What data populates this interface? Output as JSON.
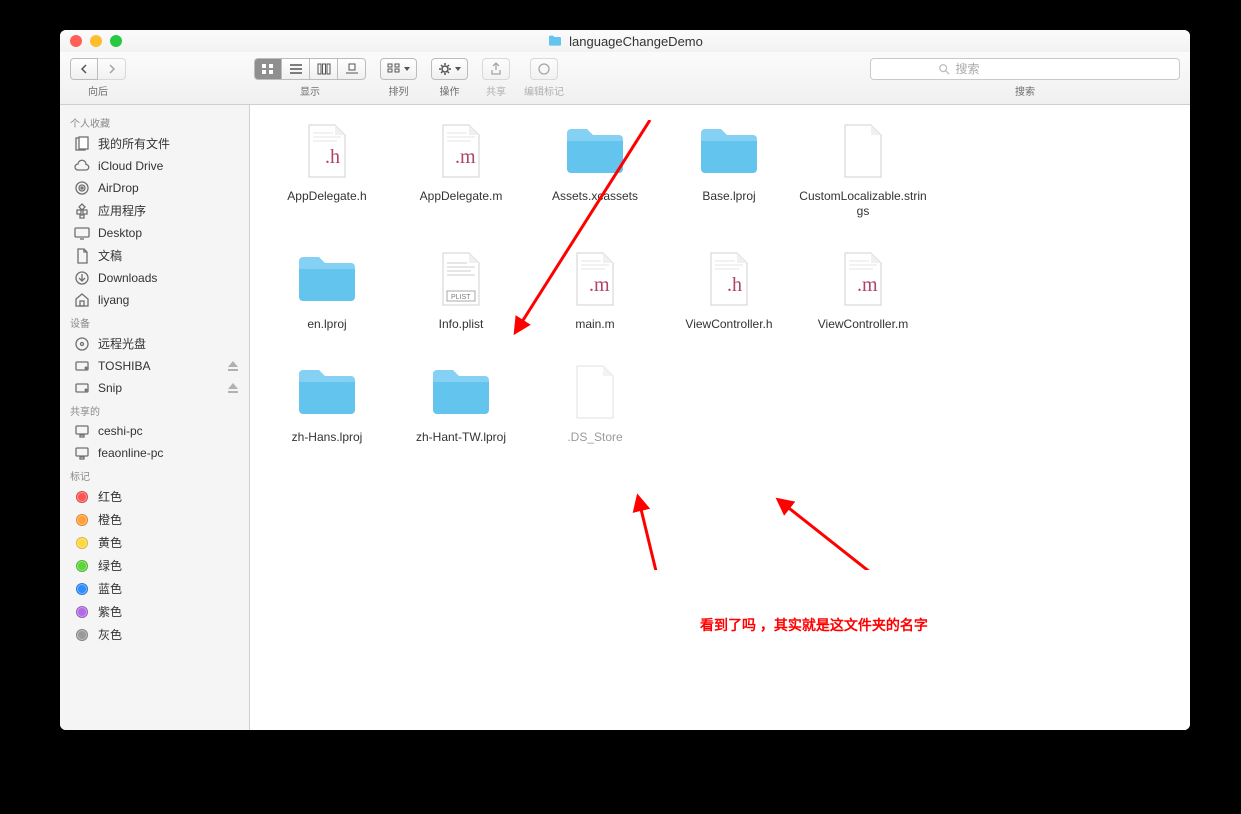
{
  "window": {
    "title": "languageChangeDemo"
  },
  "toolbar": {
    "nav_label": "向后",
    "view_label": "显示",
    "arrange_label": "排列",
    "action_label": "操作",
    "share_label": "共享",
    "tags_label": "编辑标记",
    "search_label": "搜索",
    "search_placeholder": "搜索"
  },
  "sidebar": {
    "sections": [
      {
        "header": "个人收藏",
        "items": [
          {
            "icon": "all-files",
            "label": "我的所有文件"
          },
          {
            "icon": "icloud",
            "label": "iCloud Drive"
          },
          {
            "icon": "airdrop",
            "label": "AirDrop"
          },
          {
            "icon": "apps",
            "label": "应用程序"
          },
          {
            "icon": "desktop",
            "label": "Desktop"
          },
          {
            "icon": "documents",
            "label": "文稿"
          },
          {
            "icon": "downloads",
            "label": "Downloads"
          },
          {
            "icon": "home",
            "label": "liyang"
          }
        ]
      },
      {
        "header": "设备",
        "items": [
          {
            "icon": "disc",
            "label": "远程光盘"
          },
          {
            "icon": "disk",
            "label": "TOSHIBA",
            "eject": true
          },
          {
            "icon": "disk",
            "label": "Snip",
            "eject": true
          }
        ]
      },
      {
        "header": "共享的",
        "items": [
          {
            "icon": "pc",
            "label": "ceshi-pc"
          },
          {
            "icon": "pc",
            "label": "feaonline-pc"
          }
        ]
      },
      {
        "header": "标记",
        "items": [
          {
            "tag": "#ff5454",
            "label": "红色"
          },
          {
            "tag": "#ffa136",
            "label": "橙色"
          },
          {
            "tag": "#ffd83d",
            "label": "黄色"
          },
          {
            "tag": "#5dd43b",
            "label": "绿色"
          },
          {
            "tag": "#2e8dff",
            "label": "蓝色"
          },
          {
            "tag": "#b36be3",
            "label": "紫色"
          },
          {
            "tag": "#9a9a9a",
            "label": "灰色"
          }
        ]
      }
    ]
  },
  "files": [
    {
      "type": "h",
      "name": "AppDelegate.h"
    },
    {
      "type": "m",
      "name": "AppDelegate.m"
    },
    {
      "type": "folder",
      "name": "Assets.xcassets"
    },
    {
      "type": "folder",
      "name": "Base.lproj"
    },
    {
      "type": "strings",
      "name": "CustomLocalizable.strings"
    },
    {
      "type": "folder",
      "name": "en.lproj"
    },
    {
      "type": "plist",
      "name": "Info.plist"
    },
    {
      "type": "m",
      "name": "main.m"
    },
    {
      "type": "h",
      "name": "ViewController.h"
    },
    {
      "type": "m",
      "name": "ViewController.m"
    },
    {
      "type": "folder",
      "name": "zh-Hans.lproj"
    },
    {
      "type": "folder",
      "name": "zh-Hant-TW.lproj"
    },
    {
      "type": "hidden",
      "name": ".DS_Store"
    }
  ],
  "annotation": {
    "text": "看到了吗 ，其实就是这文件夹的名字"
  }
}
